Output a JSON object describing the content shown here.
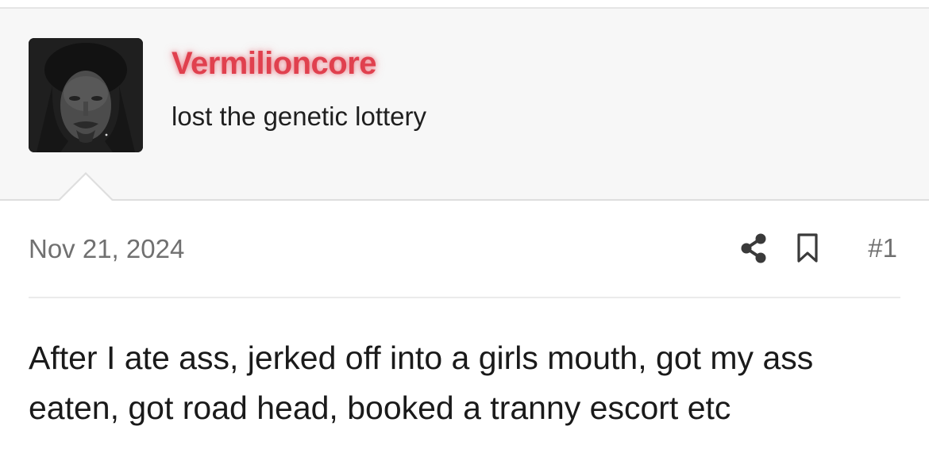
{
  "post": {
    "username": "Vermilioncore",
    "user_title": "lost the genetic lottery",
    "date": "Nov 21, 2024",
    "post_number": "#1",
    "message": "After I ate ass, jerked off into a girls mouth, got my ass eaten, got road head, booked a tranny escort etc"
  },
  "icons": {
    "share": "share-icon",
    "bookmark": "bookmark-icon"
  },
  "colors": {
    "username": "#e0404e",
    "meta_text": "#707070",
    "user_block_bg": "#f7f7f7"
  }
}
